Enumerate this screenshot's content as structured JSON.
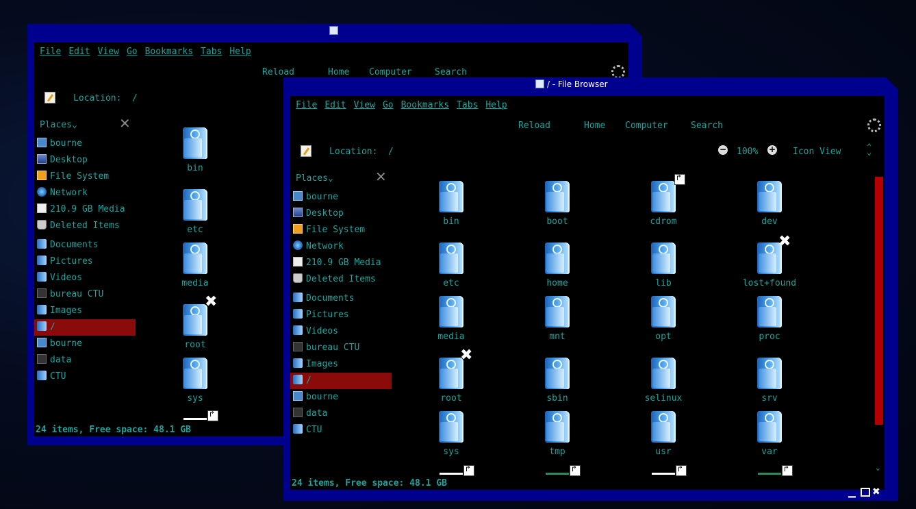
{
  "back_window": {
    "menu": [
      "File",
      "Edit",
      "View",
      "Go",
      "Bookmarks",
      "Tabs",
      "Help"
    ],
    "toolbar": [
      "Reload",
      "Home",
      "Computer",
      "Search"
    ],
    "location_label": "Location:",
    "location_value": "/",
    "places_label": "Places",
    "sidebar": [
      {
        "label": "bourne",
        "icon": "home-icon"
      },
      {
        "label": "Desktop",
        "icon": "desktop-icon"
      },
      {
        "label": "File System",
        "icon": "filesystem-icon"
      },
      {
        "label": "Network",
        "icon": "network-icon"
      },
      {
        "label": "210.9 GB Media",
        "icon": "drive-icon"
      },
      {
        "label": "Deleted Items",
        "icon": "trash-icon"
      },
      {
        "label": "Documents",
        "icon": "folder-icon"
      },
      {
        "label": "Pictures",
        "icon": "folder-icon"
      },
      {
        "label": "Videos",
        "icon": "folder-icon"
      },
      {
        "label": "bureau CTU",
        "icon": "drive-icon"
      },
      {
        "label": "Images",
        "icon": "folder-icon"
      },
      {
        "label": "/",
        "icon": "folder-icon"
      },
      {
        "label": "bourne",
        "icon": "home-icon"
      },
      {
        "label": "data",
        "icon": "drive-icon"
      },
      {
        "label": "CTU",
        "icon": "folder-icon"
      }
    ],
    "items": [
      "bin",
      "etc",
      "media",
      "root",
      "sys"
    ],
    "status": "24 items, Free space: 48.1 GB"
  },
  "front_window": {
    "title": "/ - File Browser",
    "menu": [
      "File",
      "Edit",
      "View",
      "Go",
      "Bookmarks",
      "Tabs",
      "Help"
    ],
    "toolbar": [
      "Reload",
      "Home",
      "Computer",
      "Search"
    ],
    "location_label": "Location:",
    "location_value": "/",
    "zoom": "100%",
    "view_mode": "Icon View",
    "places_label": "Places",
    "sidebar": [
      {
        "label": "bourne",
        "icon": "home-icon"
      },
      {
        "label": "Desktop",
        "icon": "desktop-icon"
      },
      {
        "label": "File System",
        "icon": "filesystem-icon"
      },
      {
        "label": "Network",
        "icon": "network-icon"
      },
      {
        "label": "210.9 GB Media",
        "icon": "drive-icon"
      },
      {
        "label": "Deleted Items",
        "icon": "trash-icon"
      },
      {
        "label": "Documents",
        "icon": "folder-icon"
      },
      {
        "label": "Pictures",
        "icon": "folder-icon"
      },
      {
        "label": "Videos",
        "icon": "folder-icon"
      },
      {
        "label": "bureau CTU",
        "icon": "drive-icon"
      },
      {
        "label": "Images",
        "icon": "folder-icon"
      },
      {
        "label": "/",
        "icon": "folder-icon"
      },
      {
        "label": "bourne",
        "icon": "home-icon"
      },
      {
        "label": "data",
        "icon": "drive-icon"
      },
      {
        "label": "CTU",
        "icon": "folder-icon"
      }
    ],
    "items": [
      "bin",
      "boot",
      "cdrom",
      "dev",
      "etc",
      "home",
      "lib",
      "lost+found",
      "media",
      "mnt",
      "opt",
      "proc",
      "root",
      "sbin",
      "selinux",
      "srv",
      "sys",
      "tmp",
      "usr",
      "var"
    ],
    "status": "24 items, Free space: 48.1 GB"
  },
  "colors": {
    "frame": "#00008e",
    "text": "#1fa39d",
    "selection": "#8b0b0b",
    "scrollbar": "#b30000"
  }
}
